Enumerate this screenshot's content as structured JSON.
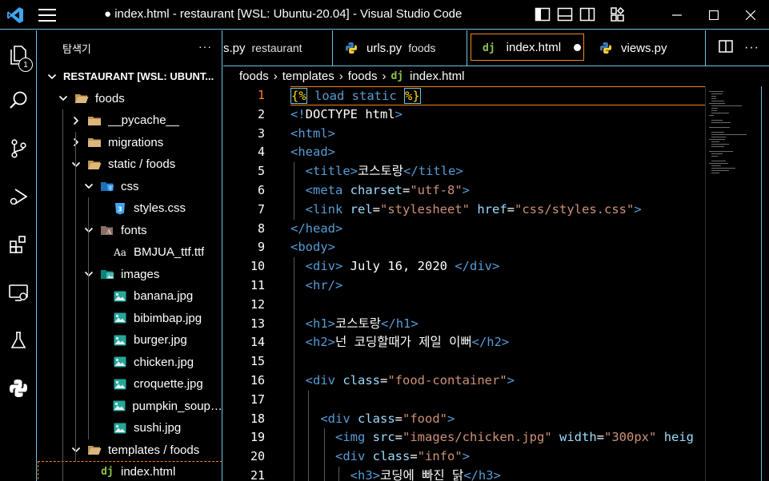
{
  "window": {
    "title": "● index.html - restaurant [WSL: Ubuntu-20.04] - Visual Studio Code"
  },
  "activity": {
    "explorer_badge": "1",
    "items": [
      "files-icon",
      "search-icon",
      "source-control-icon",
      "run-debug-icon",
      "extensions-icon",
      "remote-explorer-icon",
      "testing-icon",
      "python-icon"
    ]
  },
  "sidebar": {
    "title": "탐색기",
    "more": "···",
    "tree": [
      {
        "label": "RESTAURANT [WSL: UBUNT...",
        "type": "root",
        "depth": 0,
        "open": true
      },
      {
        "label": "foods",
        "type": "folder",
        "depth": 1,
        "open": true
      },
      {
        "label": "__pycache__",
        "type": "folder",
        "depth": 2,
        "open": false
      },
      {
        "label": "migrations",
        "type": "folder",
        "depth": 2,
        "open": false
      },
      {
        "label": "static / foods",
        "type": "folder",
        "depth": 2,
        "open": true
      },
      {
        "label": "css",
        "type": "folder-css",
        "depth": 3,
        "open": true
      },
      {
        "label": "styles.css",
        "type": "file-css",
        "depth": 4
      },
      {
        "label": "fonts",
        "type": "folder-fonts",
        "depth": 3,
        "open": true
      },
      {
        "label": "BMJUA_ttf.ttf",
        "type": "file-font",
        "depth": 4
      },
      {
        "label": "images",
        "type": "folder-images",
        "depth": 3,
        "open": true
      },
      {
        "label": "banana.jpg",
        "type": "file-image",
        "depth": 4
      },
      {
        "label": "bibimbap.jpg",
        "type": "file-image",
        "depth": 4
      },
      {
        "label": "burger.jpg",
        "type": "file-image",
        "depth": 4
      },
      {
        "label": "chicken.jpg",
        "type": "file-image",
        "depth": 4
      },
      {
        "label": "croquette.jpg",
        "type": "file-image",
        "depth": 4
      },
      {
        "label": "pumpkin_soup.j...",
        "type": "file-image",
        "depth": 4
      },
      {
        "label": "sushi.jpg",
        "type": "file-image",
        "depth": 4
      },
      {
        "label": "templates / foods",
        "type": "folder",
        "depth": 2,
        "open": true
      },
      {
        "label": "index.html",
        "type": "file-django",
        "depth": 3,
        "selected": true
      }
    ]
  },
  "tabs": [
    {
      "name": "s.py",
      "desc": "restaurant",
      "icon": "none"
    },
    {
      "name": "urls.py",
      "desc": "foods",
      "icon": "python-icon"
    },
    {
      "name": "index.html",
      "desc": "",
      "icon": "django-icon",
      "active": true,
      "dirty": true
    },
    {
      "name": "views.py",
      "desc": "",
      "icon": "python-icon"
    }
  ],
  "breadcrumb": [
    "foods",
    "templates",
    "foods",
    "index.html"
  ],
  "breadcrumb_icon": "dj",
  "editor": {
    "current_line": 1,
    "lines": [
      {
        "n": "1",
        "tokens": [
          [
            "tpl",
            "{%"
          ],
          [
            "kw",
            " load static "
          ],
          [
            "tpl",
            "%}"
          ]
        ]
      },
      {
        "n": "2",
        "tokens": [
          [
            "tag",
            "<!"
          ],
          [
            "txt",
            "DOCTYPE html"
          ],
          [
            "tag",
            ">"
          ]
        ]
      },
      {
        "n": "3",
        "tokens": [
          [
            "tag",
            "<html>"
          ]
        ]
      },
      {
        "n": "4",
        "tokens": [
          [
            "tag",
            "<head>"
          ]
        ]
      },
      {
        "n": "5",
        "tokens": [
          [
            "txt",
            "  "
          ],
          [
            "tag",
            "<title>"
          ],
          [
            "txt",
            "코스토랑"
          ],
          [
            "tag",
            "</title>"
          ]
        ]
      },
      {
        "n": "6",
        "tokens": [
          [
            "txt",
            "  "
          ],
          [
            "tag",
            "<meta "
          ],
          [
            "attr",
            "charset"
          ],
          [
            "txt",
            "="
          ],
          [
            "str",
            "\"utf-8\""
          ],
          [
            "tag",
            ">"
          ]
        ]
      },
      {
        "n": "7",
        "tokens": [
          [
            "txt",
            "  "
          ],
          [
            "tag",
            "<link "
          ],
          [
            "attr",
            "rel"
          ],
          [
            "txt",
            "="
          ],
          [
            "str",
            "\"stylesheet\""
          ],
          [
            "txt",
            " "
          ],
          [
            "attr",
            "href"
          ],
          [
            "txt",
            "="
          ],
          [
            "str",
            "\"css/styles.css\""
          ],
          [
            "tag",
            ">"
          ]
        ]
      },
      {
        "n": "8",
        "tokens": [
          [
            "tag",
            "</head>"
          ]
        ]
      },
      {
        "n": "9",
        "tokens": [
          [
            "tag",
            "<body>"
          ]
        ]
      },
      {
        "n": "10",
        "tokens": [
          [
            "txt",
            "  "
          ],
          [
            "tag",
            "<div>"
          ],
          [
            "txt",
            " July 16, 2020 "
          ],
          [
            "tag",
            "</div>"
          ]
        ]
      },
      {
        "n": "11",
        "tokens": [
          [
            "txt",
            "  "
          ],
          [
            "tag",
            "<hr/>"
          ]
        ]
      },
      {
        "n": "12",
        "tokens": []
      },
      {
        "n": "13",
        "tokens": [
          [
            "txt",
            "  "
          ],
          [
            "tag",
            "<h1>"
          ],
          [
            "txt",
            "코스토랑"
          ],
          [
            "tag",
            "</h1>"
          ]
        ]
      },
      {
        "n": "14",
        "tokens": [
          [
            "txt",
            "  "
          ],
          [
            "tag",
            "<h2>"
          ],
          [
            "txt",
            "넌 코딩할때가 제일 이뻐"
          ],
          [
            "tag",
            "</h2>"
          ]
        ]
      },
      {
        "n": "15",
        "tokens": []
      },
      {
        "n": "16",
        "tokens": [
          [
            "txt",
            "  "
          ],
          [
            "tag",
            "<div "
          ],
          [
            "attr",
            "class"
          ],
          [
            "txt",
            "="
          ],
          [
            "str",
            "\"food-container\""
          ],
          [
            "tag",
            ">"
          ]
        ]
      },
      {
        "n": "17",
        "tokens": []
      },
      {
        "n": "18",
        "tokens": [
          [
            "txt",
            "    "
          ],
          [
            "tag",
            "<div "
          ],
          [
            "attr",
            "class"
          ],
          [
            "txt",
            "="
          ],
          [
            "str",
            "\"food\""
          ],
          [
            "tag",
            ">"
          ]
        ]
      },
      {
        "n": "19",
        "tokens": [
          [
            "txt",
            "      "
          ],
          [
            "tag",
            "<img "
          ],
          [
            "attr",
            "src"
          ],
          [
            "txt",
            "="
          ],
          [
            "str",
            "\"images/chicken.jpg\""
          ],
          [
            "txt",
            " "
          ],
          [
            "attr",
            "width"
          ],
          [
            "txt",
            "="
          ],
          [
            "str",
            "\"300px\""
          ],
          [
            "txt",
            " "
          ],
          [
            "attr",
            "heig"
          ]
        ]
      },
      {
        "n": "20",
        "tokens": [
          [
            "txt",
            "      "
          ],
          [
            "tag",
            "<div "
          ],
          [
            "attr",
            "class"
          ],
          [
            "txt",
            "="
          ],
          [
            "str",
            "\"info\""
          ],
          [
            "tag",
            ">"
          ]
        ]
      },
      {
        "n": "21",
        "tokens": [
          [
            "txt",
            "        "
          ],
          [
            "tag",
            "<h3>"
          ],
          [
            "txt",
            "코딩에 빠진 닭"
          ],
          [
            "tag",
            "</h3>"
          ]
        ]
      }
    ]
  }
}
